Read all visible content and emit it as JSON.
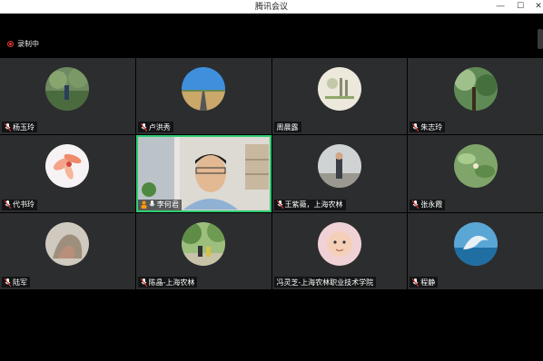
{
  "window": {
    "title": "腾讯会议",
    "minimize_glyph": "—",
    "maximize_glyph": "☐",
    "close_glyph": "✕"
  },
  "recording": {
    "label": "录制中",
    "color": "#e53935"
  },
  "participants": [
    {
      "name": "杨玉玲",
      "avatar": "garden-photo"
    },
    {
      "name": "卢洪秀",
      "avatar": "road-sky-photo"
    },
    {
      "name": "周晨露",
      "avatar": "drawing-photo"
    },
    {
      "name": "朱志玲",
      "avatar": "tree-photo"
    },
    {
      "name": "代书玲",
      "avatar": "flower-photo"
    },
    {
      "name": "李何君",
      "avatar": "live-video",
      "active": true
    },
    {
      "name": "王紫薇，上海农林",
      "avatar": "person-outdoor-photo"
    },
    {
      "name": "张永霞",
      "avatar": "leaves-photo"
    },
    {
      "name": "陆军",
      "avatar": "rock-photo"
    },
    {
      "name": "陈晶-上海农林",
      "avatar": "park-photo"
    },
    {
      "name": "冯灵芝-上海农林职业技术学院",
      "avatar": "baby-photo"
    },
    {
      "name": "程静",
      "avatar": "dolphin-photo"
    }
  ],
  "colors": {
    "active_border": "#2ecc71",
    "tile_bg": "#2c2d2f"
  }
}
